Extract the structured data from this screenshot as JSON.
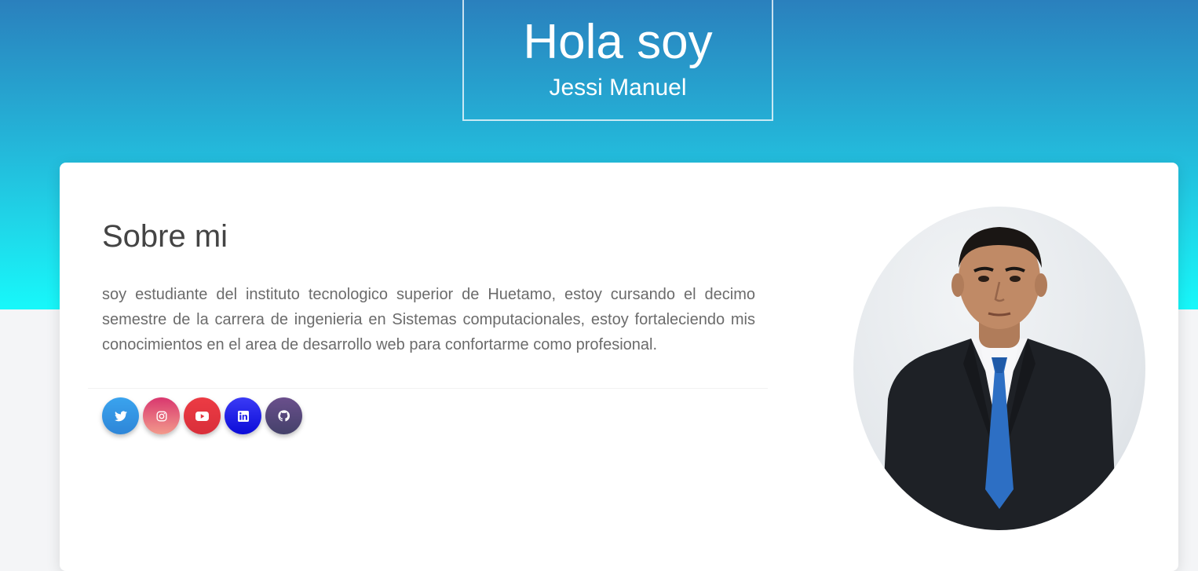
{
  "hero": {
    "title": "Hola soy",
    "subtitle": "Jessi Manuel"
  },
  "about": {
    "heading": "Sobre mi",
    "text": "soy estudiante del instituto tecnologico superior de Huetamo, estoy cursando el decimo semestre de la carrera de ingenieria en Sistemas computacionales, estoy fortaleciendo mis conocimientos en el area de desarrollo web para confortarme como profesional."
  },
  "social": [
    {
      "name": "twitter",
      "icon": "twitter-icon",
      "color": "#3d9ae8"
    },
    {
      "name": "instagram",
      "icon": "instagram-icon",
      "color": "#e35a7a"
    },
    {
      "name": "youtube",
      "icon": "youtube-icon",
      "color": "#e8343f"
    },
    {
      "name": "linkedin",
      "icon": "linkedin-icon",
      "color": "#2222ee"
    },
    {
      "name": "github",
      "icon": "github-icon",
      "color": "#5a4a78"
    }
  ],
  "profile_photo": {
    "icon": "profile-photo",
    "background": "#e6e9ec"
  }
}
